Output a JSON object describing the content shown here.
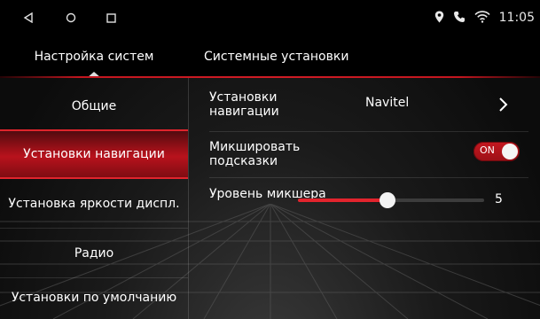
{
  "status_bar": {
    "nav_icons": [
      "back-icon",
      "home-icon",
      "recent-apps-icon"
    ],
    "status_icons": [
      "location-icon",
      "phone-icon",
      "wifi-icon"
    ],
    "time": "11:05"
  },
  "header": {
    "section_tab": "Настройка систем",
    "page_title": "Системные установки"
  },
  "sidebar": {
    "items": [
      {
        "label": "Общие",
        "active": false
      },
      {
        "label": "Установки навигации",
        "active": true
      },
      {
        "label": "Установка яркости диспл.",
        "active": false
      },
      {
        "label": "Радио",
        "active": false
      },
      {
        "label": "Установки по умолчанию",
        "active": false
      }
    ]
  },
  "settings": {
    "navigation": {
      "label": "Установки навигации",
      "value": "Navitel",
      "icon": "chevron-right-icon"
    },
    "mix_hints": {
      "label": "Микшировать подсказки",
      "toggle_text": "ON",
      "enabled": true
    },
    "mixer_level": {
      "label": "Уровень микшера",
      "value": "5",
      "level_fraction": 0.48
    }
  },
  "colors": {
    "accent": "#d01c25",
    "active_bg": "#b8121c",
    "background": "#0c0c0c",
    "text": "#ffffff"
  }
}
